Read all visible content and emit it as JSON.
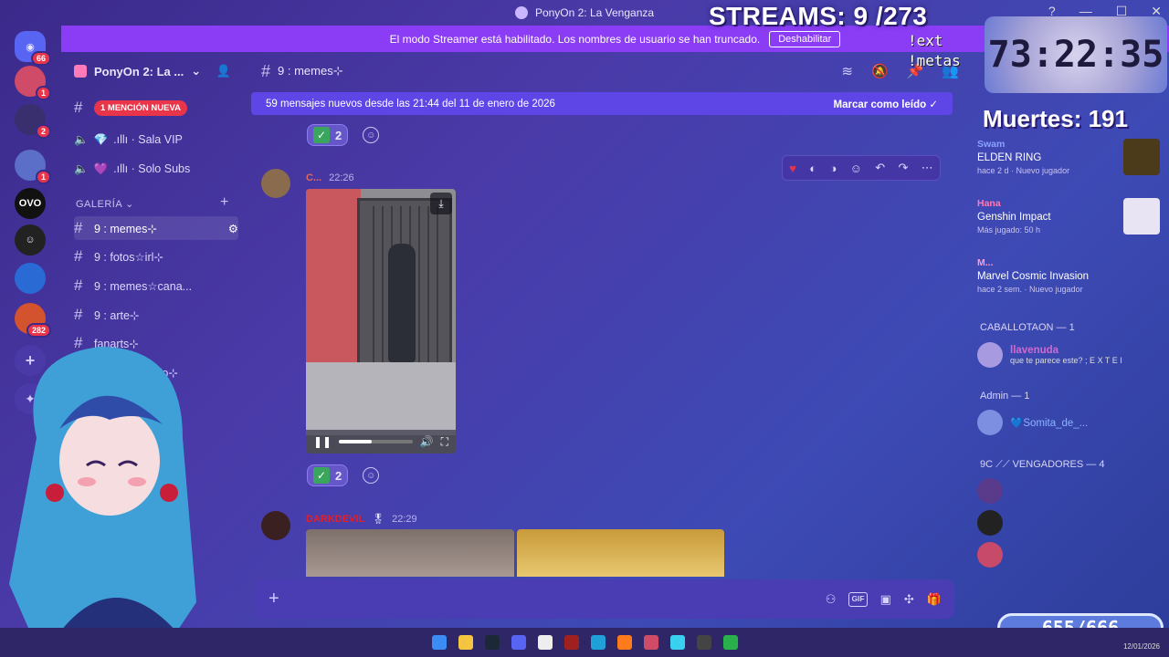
{
  "window": {
    "title": "PonyOn 2: La Venganza"
  },
  "banner": {
    "text": "El modo Streamer está habilitado. Los nombres de usuario se han truncado.",
    "button": "Deshabilitar"
  },
  "rail": {
    "badges": [
      "66",
      "1",
      "2",
      "1",
      "282"
    ],
    "labels": {
      "ovo": "OVO"
    }
  },
  "server": {
    "name": "PonyOn 2: La ..."
  },
  "sidebar": {
    "mention_pill": "1 MENCIÓN NUEVA",
    "voice": [
      {
        "label": ".ıllı · Sala VIP"
      },
      {
        "label": ".ıllı · Solo Subs"
      }
    ],
    "category_gallery": "GALERÍA",
    "channels": [
      {
        "label": "9 : memes⊹"
      },
      {
        "label": "9 : fotos☆irl⊹"
      },
      {
        "label": "9 : memes☆cana..."
      },
      {
        "label": "9 : arte⊹"
      },
      {
        "label": "fanarts⊹"
      },
      {
        "label": "9 : barrio☆rojo⊹"
      }
    ],
    "category_partial": "S"
  },
  "chat": {
    "channel": "9 : memes⊹",
    "new_messages": "59 mensajes nuevos desde las 21:44 del 11 de enero de 2026",
    "mark_read": "Marcar como leído",
    "reaction_count_1": "2",
    "reaction_count_2": "2",
    "msg1": {
      "author": "C...",
      "time": "22:26"
    },
    "msg2": {
      "author": "DARKDEVIL",
      "time": "22:29"
    },
    "video_progress": 0.45
  },
  "members": {
    "activities": [
      {
        "user": "Swam",
        "game": "ELDEN RING",
        "sub": "hace 2 d · Nuevo jugador"
      },
      {
        "user": "Hana",
        "game": "Genshin Impact",
        "sub": "Más jugado: 50 h"
      },
      {
        "user": "M...",
        "game": "Marvel Cosmic Invasion",
        "sub": "hace 2 sem. · Nuevo jugador"
      }
    ],
    "roles": [
      {
        "title": "CABALLOTAON — 1",
        "member": "llavenuda",
        "status": "que te parece este? ; E X T E I"
      },
      {
        "title": "Admin — 1",
        "member": "💙Somita_de_...",
        "status": ""
      },
      {
        "title": "9C ⟋⟋ VENGADORES — 4",
        "member": "",
        "status": ""
      }
    ]
  },
  "overlays": {
    "streams": "STREAMS: 9 /273",
    "commands": [
      "!ext",
      "!metas"
    ],
    "timer": "73:22:35",
    "deaths": "Muertes: 191",
    "counter": "655/666"
  },
  "taskbar": {
    "date": "12/01/2026"
  },
  "colors": {
    "accent": "#8b3cf5",
    "newbar": "#5d45e6",
    "mention": "#e8354a",
    "author2": "#e0202a"
  }
}
